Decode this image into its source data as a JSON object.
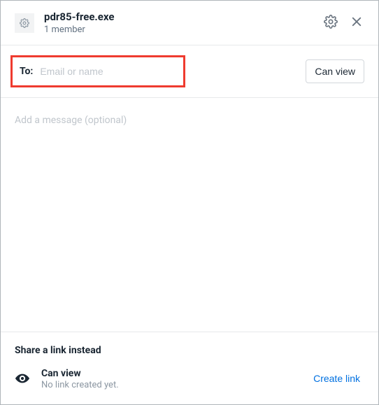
{
  "header": {
    "filename": "pdr85-free.exe",
    "member_count": "1 member"
  },
  "to": {
    "label": "To:",
    "placeholder": "Email or name",
    "value": ""
  },
  "permission_button": "Can view",
  "message": {
    "placeholder": "Add a message (optional)",
    "value": ""
  },
  "footer": {
    "title": "Share a link instead",
    "link_title": "Can view",
    "link_sub": "No link created yet.",
    "create_link": "Create link"
  }
}
